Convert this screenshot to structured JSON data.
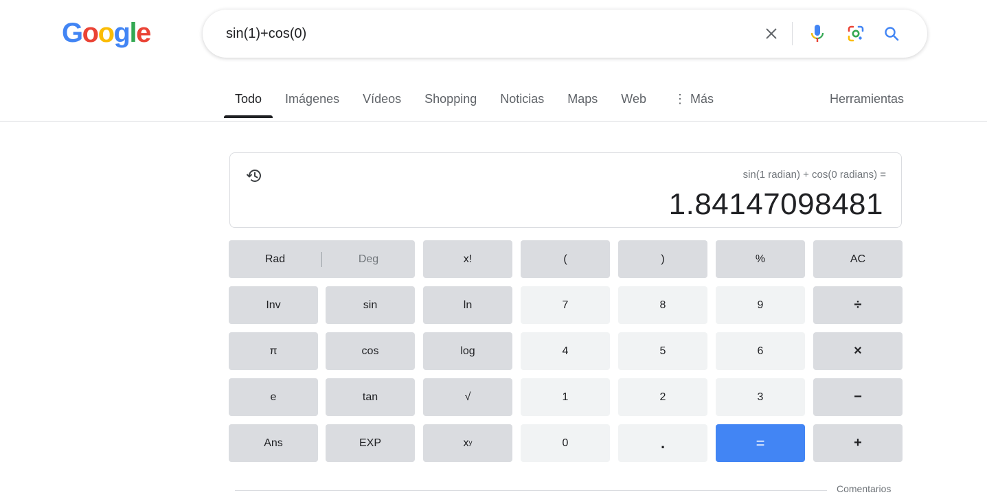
{
  "logo": [
    "G",
    "o",
    "o",
    "g",
    "l",
    "e"
  ],
  "search": {
    "value": "sin(1)+cos(0)"
  },
  "icons": {
    "clear": "close-icon",
    "mic": "microphone-icon",
    "lens": "google-lens-icon",
    "search": "search-icon",
    "history": "history-icon"
  },
  "tabs": [
    {
      "label": "Todo",
      "active": true
    },
    {
      "label": "Imágenes"
    },
    {
      "label": "Vídeos"
    },
    {
      "label": "Shopping"
    },
    {
      "label": "Noticias"
    },
    {
      "label": "Maps"
    },
    {
      "label": "Web"
    },
    {
      "label": "Más",
      "icon": "⋮"
    }
  ],
  "tools_label": "Herramientas",
  "calculator": {
    "expression": "sin(1 radian) + cos(0 radians) =",
    "result": "1.84147098481",
    "mode": {
      "rad": "Rad",
      "deg": "Deg",
      "active": "Rad"
    },
    "keys": {
      "fact": "x!",
      "lparen": "(",
      "rparen": ")",
      "percent": "%",
      "ac": "AC",
      "inv": "Inv",
      "sin": "sin",
      "ln": "ln",
      "k7": "7",
      "k8": "8",
      "k9": "9",
      "div": "÷",
      "pi": "π",
      "cos": "cos",
      "log": "log",
      "k4": "4",
      "k5": "5",
      "k6": "6",
      "mul": "×",
      "e": "e",
      "tan": "tan",
      "sqrt": "√",
      "k1": "1",
      "k2": "2",
      "k3": "3",
      "sub": "−",
      "ans": "Ans",
      "exp": "EXP",
      "pow_base": "x",
      "pow_exp": "y",
      "k0": "0",
      "dot": ".",
      "eq": "=",
      "add": "+"
    }
  },
  "feedback_label": "Comentarios",
  "colors": {
    "accent_blue": "#4285f4",
    "fn_key_bg": "#dadce0",
    "num_key_bg": "#f1f3f4"
  }
}
